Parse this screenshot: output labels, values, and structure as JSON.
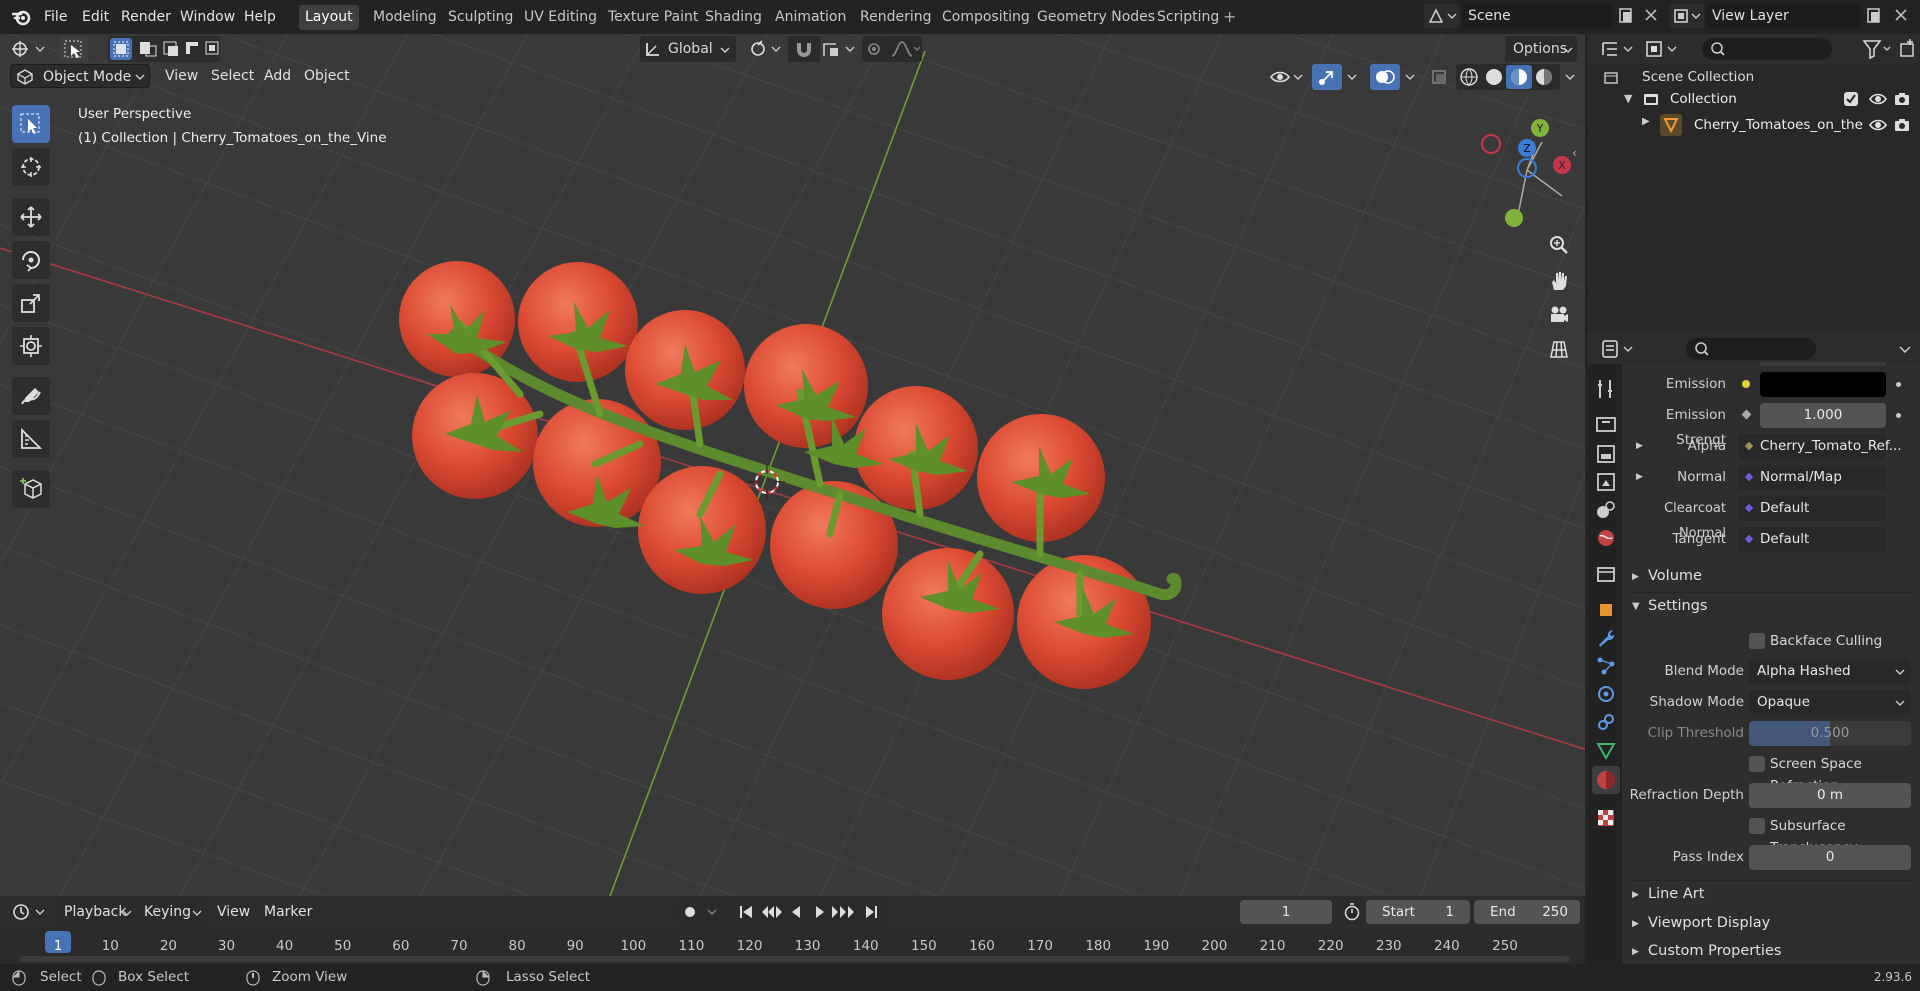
{
  "menu": {
    "file": "File",
    "edit": "Edit",
    "render": "Render",
    "window": "Window",
    "help": "Help"
  },
  "workspaces": [
    "Layout",
    "Modeling",
    "Sculpting",
    "UV Editing",
    "Texture Paint",
    "Shading",
    "Animation",
    "Rendering",
    "Compositing",
    "Geometry Nodes",
    "Scripting"
  ],
  "scene": {
    "name": "Scene",
    "view_layer": "View Layer"
  },
  "viewport": {
    "transform_orientation": "Global",
    "options_label": "Options",
    "mode": "Object Mode",
    "menus": {
      "view": "View",
      "select": "Select",
      "add": "Add",
      "object": "Object"
    },
    "overlay_line1": "User Perspective",
    "overlay_line2": "(1) Collection | Cherry_Tomatoes_on_the_Vine",
    "gizmo": {
      "x": "X",
      "y": "Y",
      "z": "Z"
    }
  },
  "outliner": {
    "scene_collection": "Scene Collection",
    "collection": "Collection",
    "object": "Cherry_Tomatoes_on_the"
  },
  "properties": {
    "emission_label": "Emission",
    "emission_strength_label": "Emission Strengt",
    "emission_strength_value": "1.000",
    "alpha_label": "Alpha",
    "alpha_value": "Cherry_Tomato_Ref...",
    "normal_label": "Normal",
    "normal_value": "Normal/Map",
    "clearcoat_normal_label": "Clearcoat Normal",
    "clearcoat_normal_value": "Default",
    "tangent_label": "Tangent",
    "tangent_value": "Default",
    "volume_section": "Volume",
    "settings_section": "Settings",
    "backface_culling": "Backface Culling",
    "blend_mode_label": "Blend Mode",
    "blend_mode_value": "Alpha Hashed",
    "shadow_mode_label": "Shadow Mode",
    "shadow_mode_value": "Opaque",
    "clip_threshold_label": "Clip Threshold",
    "clip_threshold_value": "0.500",
    "screen_space_refraction": "Screen Space Refraction",
    "refraction_depth_label": "Refraction Depth",
    "refraction_depth_value": "0 m",
    "subsurface_translucency": "Subsurface Translucency",
    "pass_index_label": "Pass Index",
    "pass_index_value": "0",
    "line_art_section": "Line Art",
    "viewport_display_section": "Viewport Display",
    "custom_properties_section": "Custom Properties"
  },
  "timeline": {
    "playback": "Playback",
    "keying": "Keying",
    "view": "View",
    "marker": "Marker",
    "current_frame": "1",
    "start_label": "Start",
    "start_value": "1",
    "end_label": "End",
    "end_value": "250",
    "frame_marks": [
      "1",
      "10",
      "20",
      "30",
      "40",
      "50",
      "60",
      "70",
      "80",
      "90",
      "100",
      "110",
      "120",
      "130",
      "140",
      "150",
      "160",
      "170",
      "180",
      "190",
      "200",
      "210",
      "220",
      "230",
      "240",
      "250"
    ]
  },
  "statusbar": {
    "select": "Select",
    "box_select": "Box Select",
    "zoom_view": "Zoom View",
    "lasso_select": "Lasso Select",
    "version": "2.93.6"
  },
  "colors": {
    "accent": "#4772b3",
    "tomato": "#d9442e",
    "stem": "#5d8a2e",
    "x_axis": "#c7374a",
    "y_axis": "#7fb33a"
  }
}
